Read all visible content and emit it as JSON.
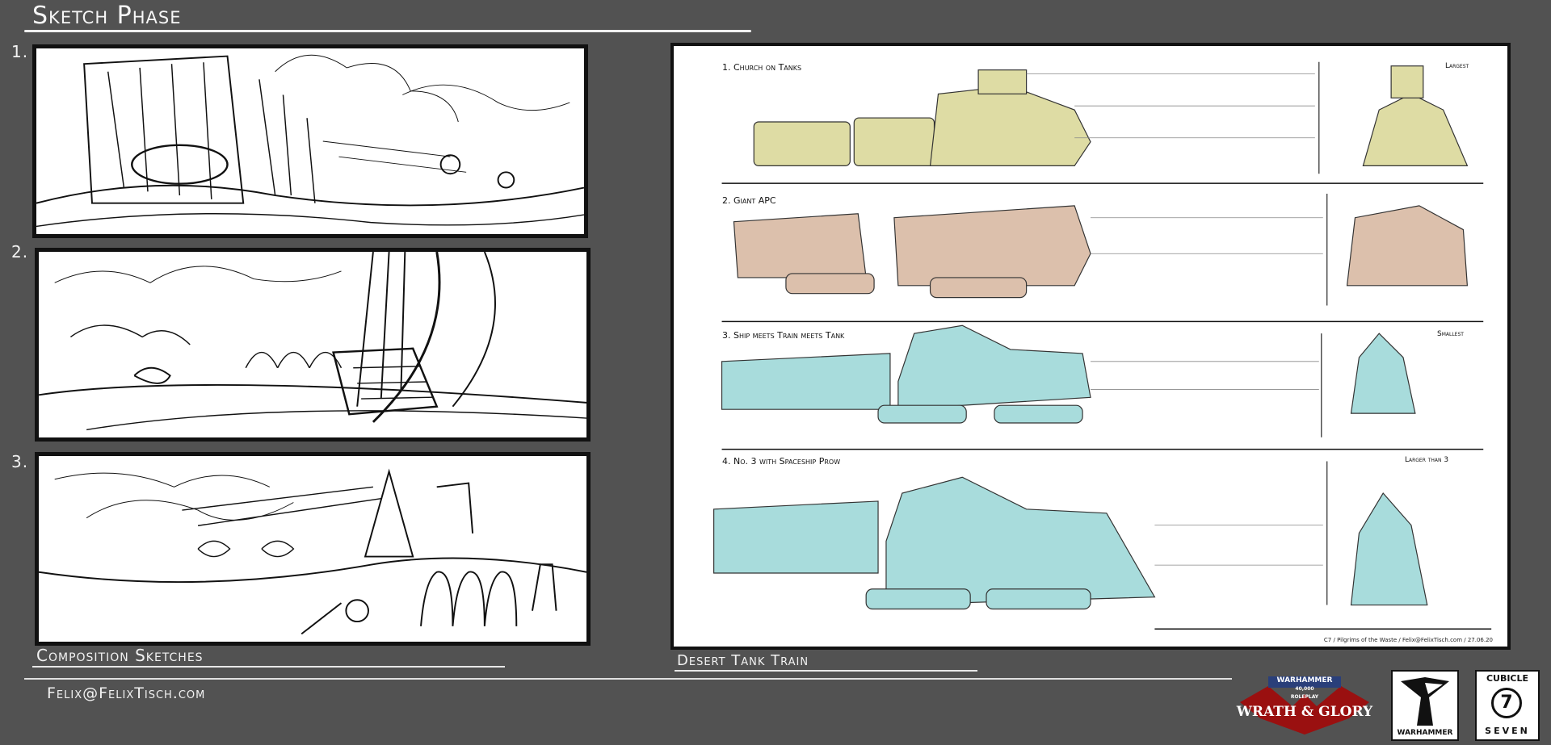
{
  "header": {
    "title": "Sketch Phase"
  },
  "panels": [
    {
      "number": "1."
    },
    {
      "number": "2."
    },
    {
      "number": "3."
    }
  ],
  "composition": {
    "caption": "Composition Sketches"
  },
  "sheet": {
    "rows": [
      {
        "label": "1. Church on Tanks",
        "tag": "Largest",
        "color": "#dedca4"
      },
      {
        "label": "2. Giant APC",
        "tag": "",
        "color": "#dcc0ac"
      },
      {
        "label": "3. Ship meets Train meets Tank",
        "tag": "Smallest",
        "color": "#a8dcdc"
      },
      {
        "label": "4. No. 3 with Spaceship Prow",
        "tag": "Larger than 3",
        "color": "#a8dcdc"
      }
    ],
    "credit": "C7 / Pilgrims of the Waste / Felix@FelixTisch.com / 27.06.20"
  },
  "train": {
    "caption": "Desert Tank Train"
  },
  "footer": {
    "email": "Felix@FelixTisch.com"
  },
  "logos": {
    "wrath_glory": {
      "line1": "WARHAMMER",
      "line2": "40,000",
      "line3": "ROLEPLAY",
      "name": "WRATH & GLORY"
    },
    "warhammer": {
      "name": "WARHAMMER"
    },
    "cubicle7": {
      "line1": "CUBICLE",
      "numeral": "7",
      "line2": "SEVEN"
    }
  }
}
